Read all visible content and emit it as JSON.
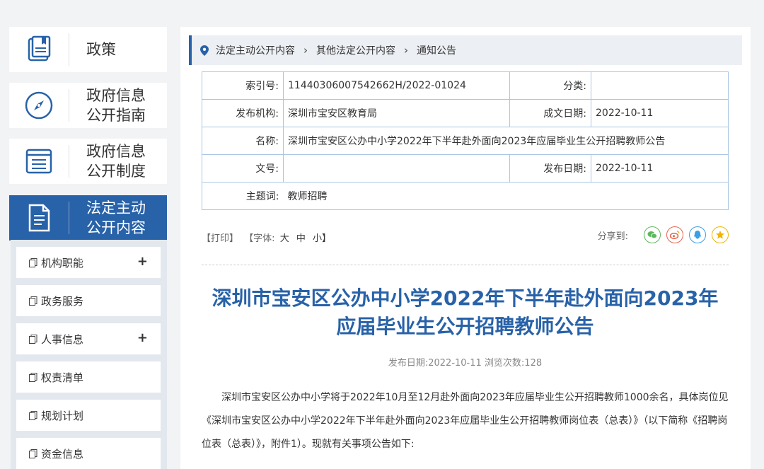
{
  "sidebar": {
    "cards": [
      {
        "label": "政策",
        "icon": "book-icon"
      },
      {
        "label": "政府信息\n公开指南",
        "icon": "compass-icon"
      },
      {
        "label": "政府信息\n公开制度",
        "icon": "list-icon"
      },
      {
        "label": "法定主动\n公开内容",
        "icon": "document-icon",
        "active": true
      }
    ],
    "submenu": [
      {
        "label": "机构职能",
        "expandable": "+"
      },
      {
        "label": "政务服务"
      },
      {
        "label": "人事信息",
        "expandable": "+"
      },
      {
        "label": "权责清单"
      },
      {
        "label": "规划计划"
      },
      {
        "label": "资金信息"
      }
    ]
  },
  "breadcrumb": {
    "items": [
      "法定主动公开内容",
      "其他法定公开内容",
      "通知公告"
    ],
    "separator": "›"
  },
  "info": {
    "index_label": "索引号:",
    "index_value": "11440306007542662H/2022-01024",
    "category_label": "分类:",
    "category_value": "",
    "publisher_label": "发布机构:",
    "publisher_value": "深圳市宝安区教育局",
    "written_date_label": "成文日期:",
    "written_date_value": "2022-10-11",
    "name_label": "名称:",
    "name_value": "深圳市宝安区公办中小学2022年下半年赴外面向2023年应届毕业生公开招聘教师公告",
    "doc_no_label": "文号:",
    "doc_no_value": "",
    "publish_date_label": "发布日期:",
    "publish_date_value": "2022-10-11",
    "subject_label": "主题词:",
    "subject_value": "教师招聘"
  },
  "tools": {
    "print": "【打印】",
    "font_label": "【字体:",
    "font_large": "大",
    "font_medium": "中",
    "font_small": "小】",
    "share_label": "分享到:",
    "share_icons": [
      "wechat-icon",
      "weibo-icon",
      "qq-icon",
      "qzone-icon"
    ]
  },
  "article": {
    "title_line1": "深圳市宝安区公办中小学2022年下半年赴外面向2023年",
    "title_line2": "应届毕业生公开招聘教师公告",
    "meta": "发布日期:2022-10-11  浏览次数:128",
    "paragraph": "深圳市宝安区公办中小学将于2022年10月至12月赴外面向2023年应届毕业生公开招聘教师1000余名，具体岗位见《深圳市宝安区公办中小学2022年下半年赴外面向2023年应届毕业生公开招聘教师岗位表（总表）》（以下简称《招聘岗位表（总表）》，附件1）。现就有关事项公告如下:"
  },
  "colors": {
    "accent": "#2862a8",
    "wechat": "#5cb85c",
    "weibo": "#e8624a",
    "qq": "#3a9ee8",
    "qzone": "#f0b400"
  }
}
